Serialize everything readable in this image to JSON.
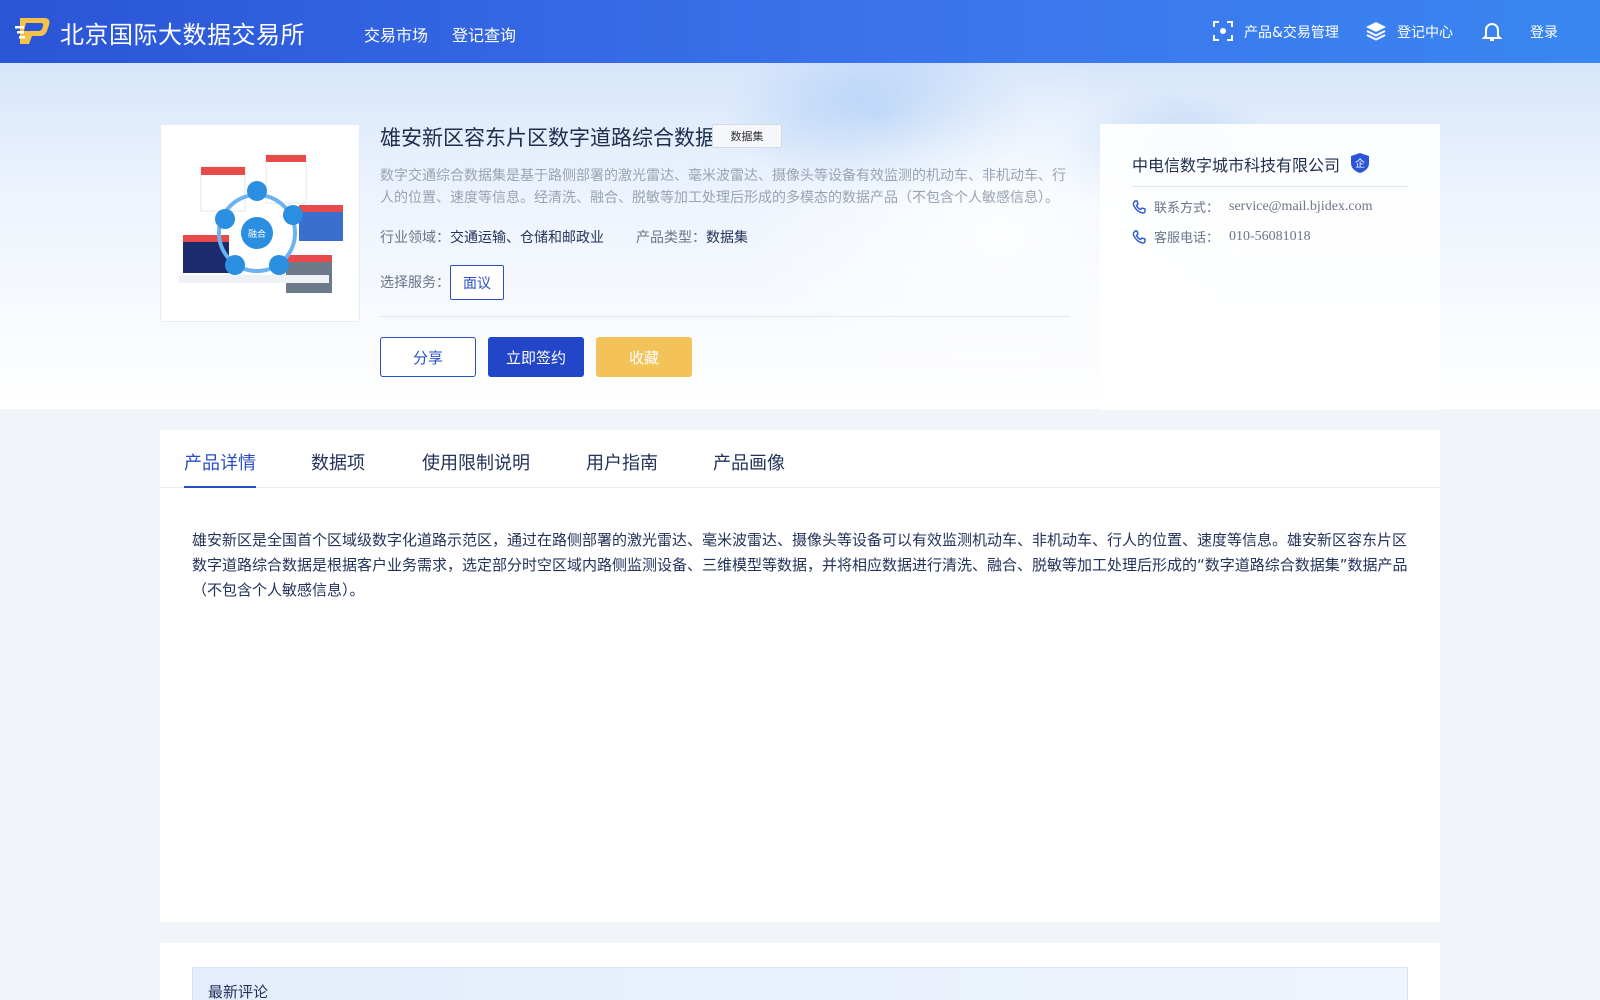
{
  "header": {
    "logo_text": "北京国际大数据交易所",
    "nav": [
      "交易市场",
      "登记查询"
    ],
    "product_mgmt": "产品&交易管理",
    "register_center": "登记中心",
    "login": "登录"
  },
  "product": {
    "title": "雄安新区容东片区数字道路综合数据",
    "tag": "数据集",
    "description": "数字交通综合数据集是基于路侧部署的激光雷达、毫米波雷达、摄像头等设备有效监测的机动车、非机动车、行人的位置、速度等信息。经清洗、融合、脱敏等加工处理后形成的多模态的数据产品（不包含个人敏感信息）。",
    "industry_label": "行业领域：",
    "industry_value": "交通运输、仓储和邮政业",
    "type_label": "产品类型：",
    "type_value": "数据集",
    "service_label": "选择服务：",
    "service_option": "面议",
    "thumb_center": "融合",
    "share": "分享",
    "sign": "立即签约",
    "favorite": "收藏"
  },
  "company": {
    "name": "中电信数字城市科技有限公司",
    "badge": "企",
    "contact_label": "联系方式：",
    "contact_value": "service@mail.bjidex.com",
    "phone_label": "客服电话：",
    "phone_value": "010-56081018"
  },
  "tabs": [
    "产品详情",
    "数据项",
    "使用限制说明",
    "用户指南",
    "产品画像"
  ],
  "detail": {
    "text": "雄安新区是全国首个区域级数字化道路示范区，通过在路侧部署的激光雷达、毫米波雷达、摄像头等设备可以有效监测机动车、非机动车、行人的位置、速度等信息。雄安新区容东片区数字道路综合数据是根据客户业务需求，选定部分时空区域内路侧监测设备、三维模型等数据，并将相应数据进行清洗、融合、脱敏等加工处理后形成的“数字道路综合数据集”数据产品（不包含个人敏感信息）。"
  },
  "comments": {
    "title": "最新评论"
  },
  "colors": {
    "brand": "#2a55d6",
    "primary_button": "#2346c8",
    "favorite_button": "#f3c35a"
  }
}
